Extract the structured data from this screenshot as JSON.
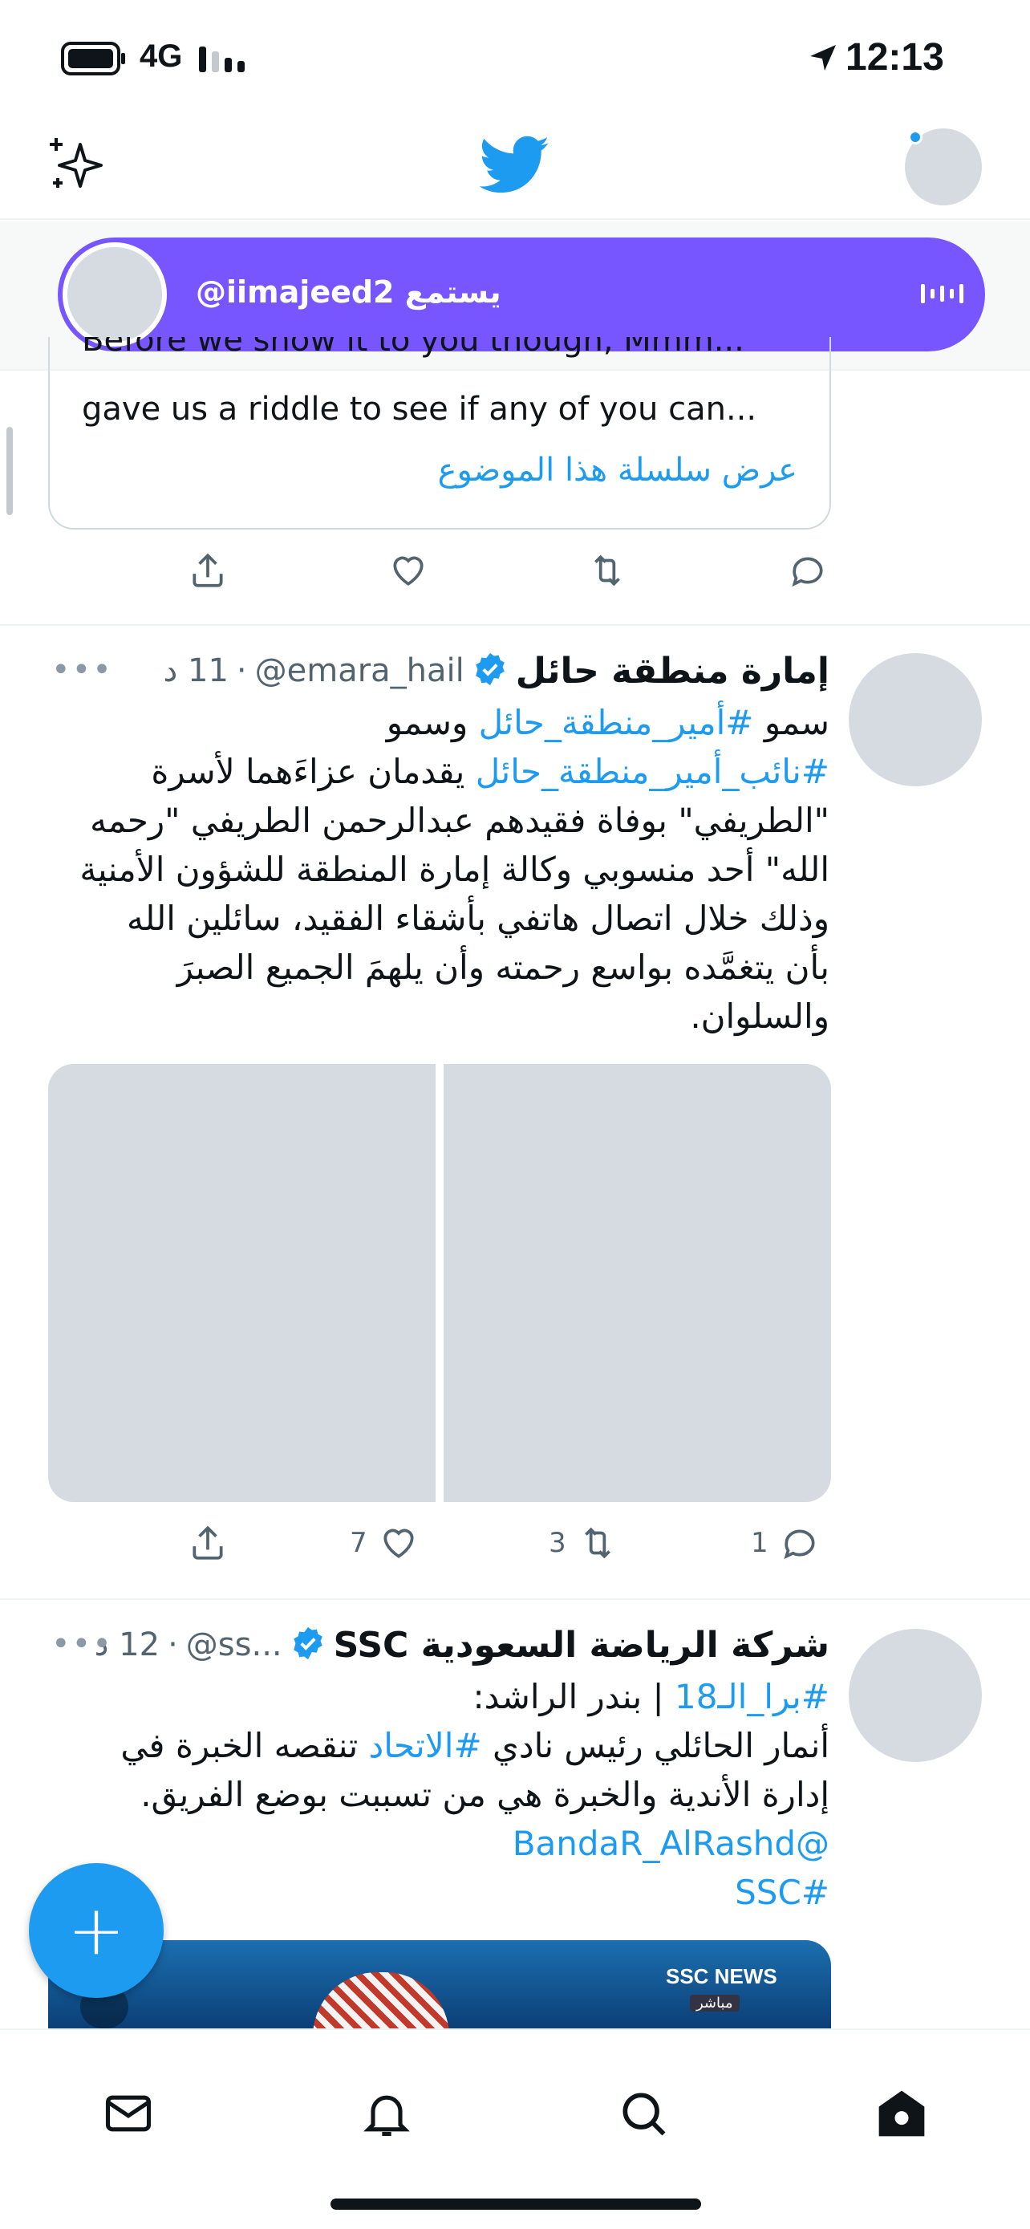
{
  "status_bar": {
    "network": "4G",
    "time": "12:13"
  },
  "spaces": {
    "listening_label": "@iimajeed2 يستمع"
  },
  "quoted_tweet": {
    "partial_line": "Before we show it to you though, Mmm...",
    "line": "gave us a riddle to see if any of you can...",
    "show_thread": "عرض سلسلة هذا الموضوع"
  },
  "tweets": [
    {
      "name": "إمارة منطقة حائل",
      "handle": "@emara_hail",
      "time": "11 د",
      "lines": [
        {
          "parts": [
            {
              "t": "سمو ",
              "link": false
            },
            {
              "t": "#أمير_منطقة_حائل",
              "link": true
            },
            {
              "t": " وسمو",
              "link": false
            }
          ]
        },
        {
          "parts": [
            {
              "t": "#نائب_أمير_منطقة_حائل",
              "link": true
            },
            {
              "t": " يقدمان عزاءَهما لأسرة",
              "link": false
            }
          ]
        },
        {
          "parts": [
            {
              "t": "\"الطريفي\" بوفاة فقيدهم عبدالرحمن الطريفي \"رحمه",
              "link": false
            }
          ]
        },
        {
          "parts": [
            {
              "t": "الله\" أحد منسوبي وكالة إمارة المنطقة للشؤون الأمنية",
              "link": false
            }
          ]
        },
        {
          "parts": [
            {
              "t": "وذلك خلال اتصال هاتفي بأشقاء الفقيد، سائلين الله",
              "link": false
            }
          ]
        },
        {
          "parts": [
            {
              "t": "بأن يتغمَّده بواسع رحمته وأن يلهمَ الجميع الصبرَ",
              "link": false
            }
          ]
        },
        {
          "parts": [
            {
              "t": "والسلوان.",
              "link": false
            }
          ]
        }
      ],
      "replies": "1",
      "retweets": "3",
      "likes": "7"
    },
    {
      "name": "شركة الرياضة السعودية SSC",
      "handle": "@ss...",
      "time": "12 د",
      "lines": [
        {
          "parts": [
            {
              "t": "#برا_الـ18",
              "link": true
            },
            {
              "t": " | بندر الراشد:",
              "link": false
            }
          ]
        },
        {
          "parts": [
            {
              "t": "أنمار الحائلي رئيس نادي ",
              "link": false
            },
            {
              "t": "#الاتحاد",
              "link": true
            },
            {
              "t": " تنقصه الخبرة في",
              "link": false
            }
          ]
        },
        {
          "parts": [
            {
              "t": "إدارة الأندية والخبرة هي من تسببت بوضع الفريق.",
              "link": false
            }
          ]
        },
        {
          "parts": [
            {
              "t": "@BandaR_AlRashd",
              "link": true
            }
          ]
        },
        {
          "parts": [
            {
              "t": "#SSC",
              "link": true
            }
          ]
        }
      ],
      "media_badge": "SSC NEWS",
      "media_live": "مباشر"
    }
  ],
  "fab": {
    "symbol": "+"
  },
  "tabs": [
    "mail-icon",
    "bell-icon",
    "search-icon",
    "home-icon"
  ],
  "colors": {
    "twitter_blue": "#1d9bf0",
    "spaces_purple": "#7856ff"
  }
}
